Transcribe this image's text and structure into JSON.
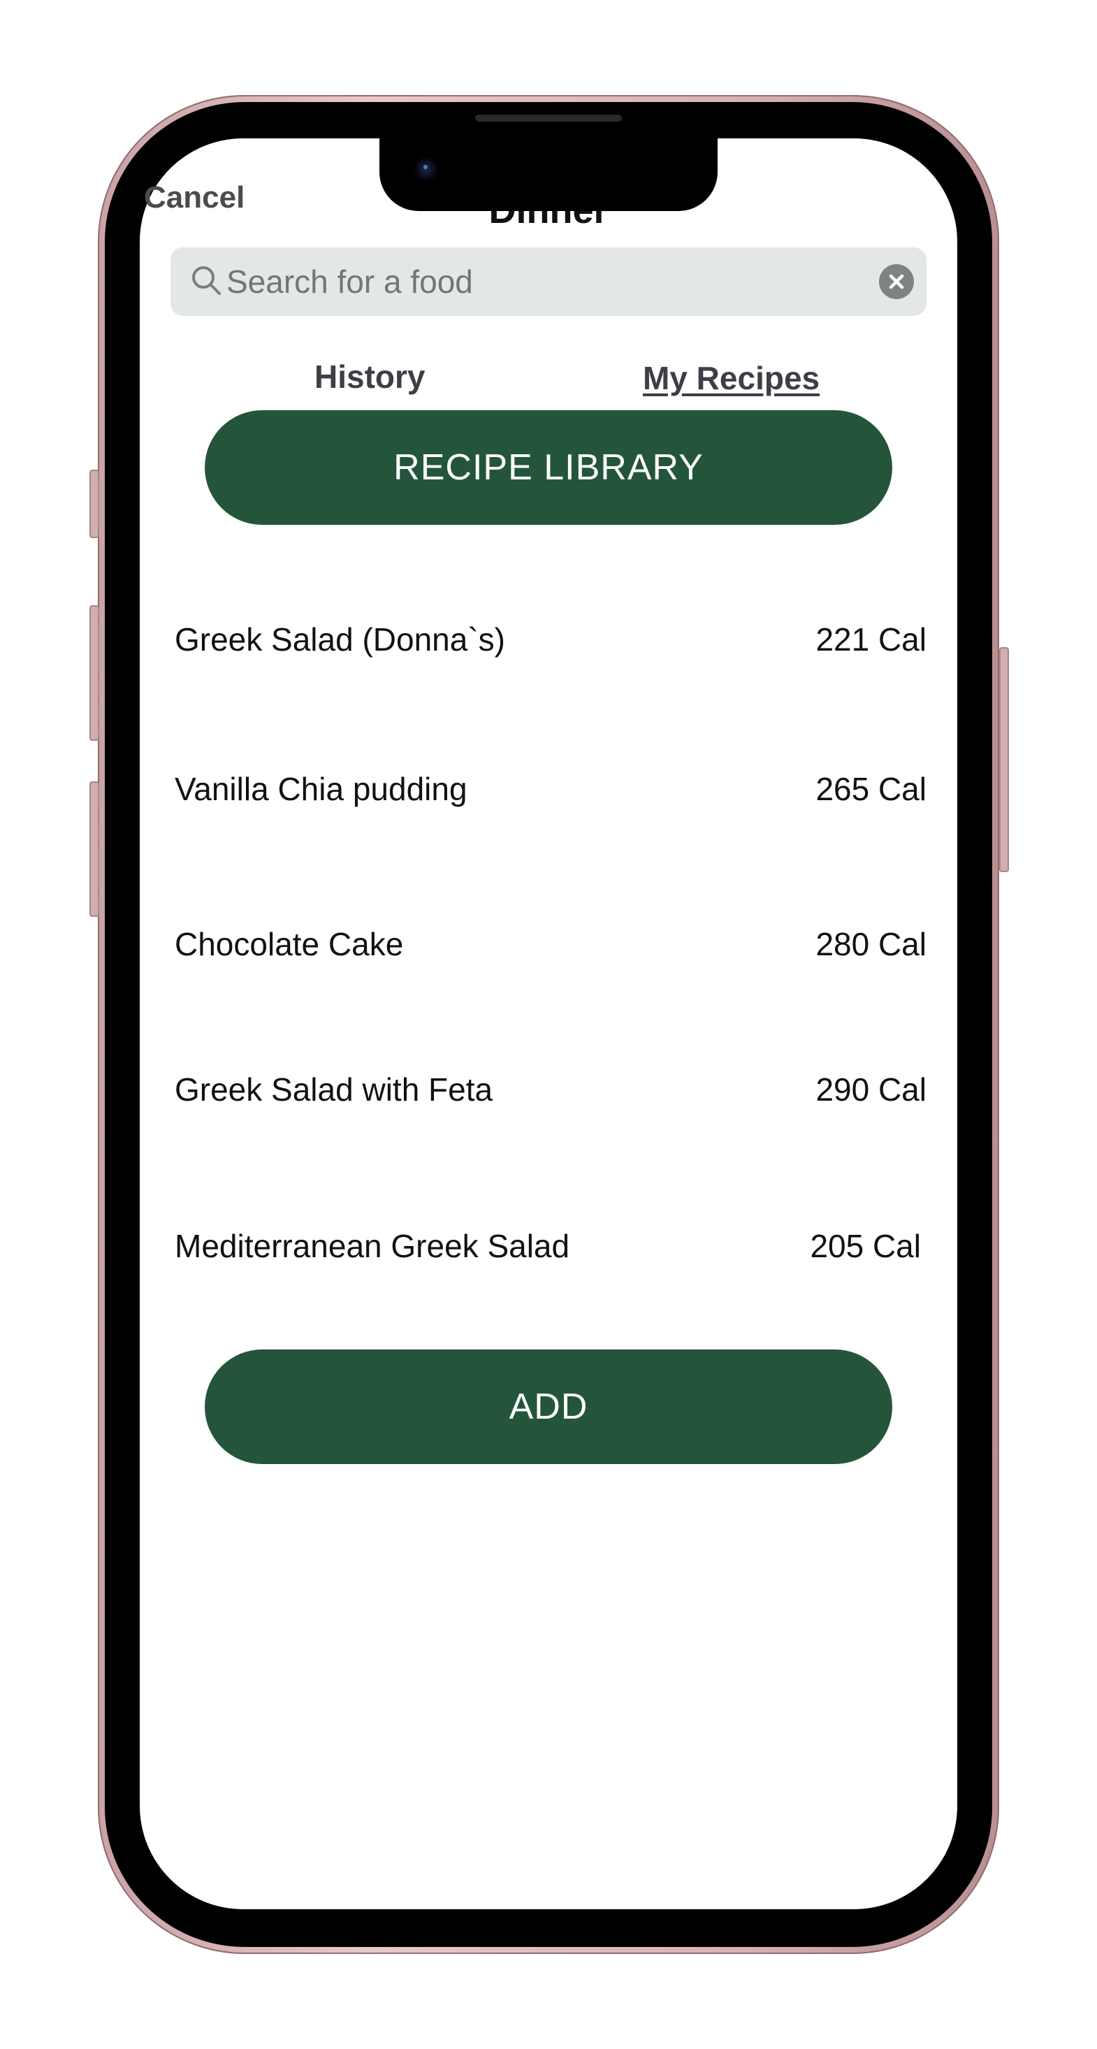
{
  "header": {
    "cancel_label": "Cancel",
    "title": "Dinner"
  },
  "search": {
    "placeholder": "Search for a food",
    "icon": "search-icon",
    "clear_icon": "clear-circle-icon"
  },
  "tabs": [
    {
      "label": "History"
    },
    {
      "label": "My Recipes"
    }
  ],
  "recipe_library_label": "RECIPE LIBRARY",
  "food_list": [
    {
      "name": "Greek Salad (Donna`s)",
      "calories": "221 Cal"
    },
    {
      "name": "Vanilla Chia pudding",
      "calories": "265 Cal"
    },
    {
      "name": "Chocolate Cake",
      "calories": "280 Cal"
    },
    {
      "name": "Greek Salad with Feta",
      "calories": "290 Cal"
    },
    {
      "name": "Mediterranean Greek Salad",
      "calories": "205 Cal"
    }
  ],
  "add_label": "ADD",
  "colors": {
    "accent": "#24553b",
    "search_bg": "#e3e8e6",
    "phone_frame": "#d8b3b5"
  }
}
